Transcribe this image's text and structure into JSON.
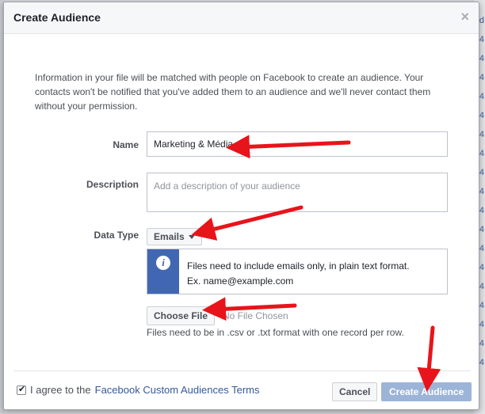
{
  "modal": {
    "title": "Create Audience",
    "close_glyph": "×",
    "intro": "Information in your file will be matched with people on Facebook to create an audience. Your contacts won't be notified that you've added them to an audience and we'll never contact them without your permission."
  },
  "form": {
    "name_label": "Name",
    "name_value": "Marketing & Média",
    "description_label": "Description",
    "description_placeholder": "Add a description of your audience",
    "data_type_label": "Data Type",
    "data_type_value": "Emails",
    "info_glyph": "i",
    "info_line1": "Files need to include emails only, in plain text format.",
    "info_line2": "Ex. name@example.com",
    "choose_file_label": "Choose File",
    "no_file_text": "No File Chosen",
    "file_hint": "Files need to be in .csv or .txt format with one record per row."
  },
  "footer": {
    "agree_text": "I agree to the",
    "terms_link": "Facebook Custom Audiences Terms",
    "cancel_label": "Cancel",
    "create_label": "Create Audience",
    "agree_checked": true
  },
  "background": {
    "right_numbers": [
      "d",
      "4",
      "4",
      "4",
      "4",
      "4",
      "4",
      "4",
      "4",
      "4",
      "4",
      "4",
      "4",
      "4",
      "4",
      "4",
      "4",
      "4",
      "4"
    ]
  },
  "colors": {
    "header_bg": "#f6f7f9",
    "info_stripe": "#4267b2",
    "link": "#365899",
    "create_button_disabled": "#9cb4d8",
    "annotation_arrow": "#e8141b"
  },
  "icons": {
    "close": "close-icon",
    "info": "info-icon",
    "caret": "caret-down-icon",
    "checkbox": "checkmark-icon"
  }
}
